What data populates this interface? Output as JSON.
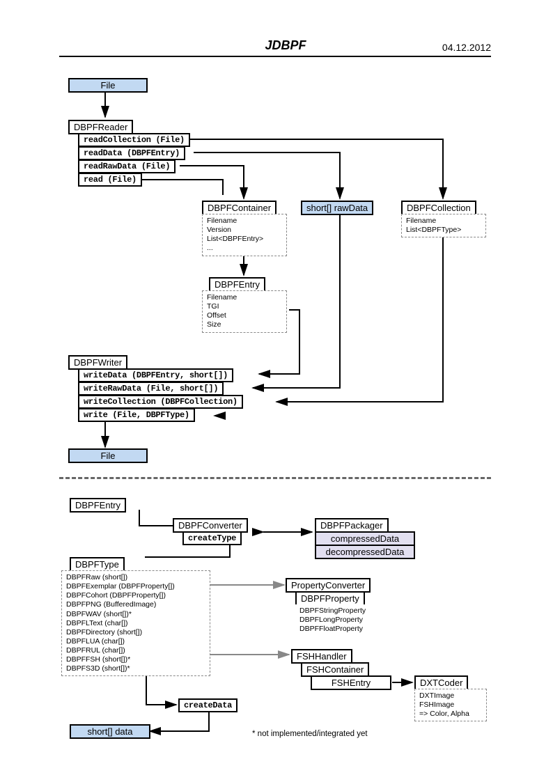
{
  "header": {
    "title": "JDBPF",
    "date": "04.12.2012"
  },
  "file_top": "File",
  "reader": {
    "name": "DBPFReader",
    "m1": "readCollection (File)",
    "m2": "readData (DBPFEntry)",
    "m3": "readRawData (File)",
    "m4": "read (File)"
  },
  "container": {
    "name": "DBPFContainer",
    "attrs": "Filename\nVersion\nList<DBPFEntry>\n..."
  },
  "rawdata": "short[] rawData",
  "collection": {
    "name": "DBPFCollection",
    "attrs": "Filename\nList<DBPFType>"
  },
  "entry": {
    "name": "DBPFEntry",
    "attrs": "Filename\nTGI\nOffset\nSize"
  },
  "writer": {
    "name": "DBPFWriter",
    "m1": "writeData (DBPFEntry, short[])",
    "m2": "writeRawData (File, short[])",
    "m3": "writeCollection (DBPFCollection)",
    "m4": "write (File, DBPFType)"
  },
  "file_bot": "File",
  "entry2": "DBPFEntry",
  "converter": {
    "name": "DBPFConverter",
    "m": "createType"
  },
  "packager": {
    "name": "DBPFPackager",
    "m1": "compressedData",
    "m2": "decompressedData"
  },
  "type": {
    "name": "DBPFType",
    "attrs": "DBPFRaw (short[])\nDBPFExemplar (DBPFProperty[])\nDBPFCohort (DBPFProperty[])\nDBPFPNG (BufferedImage)\nDBPFWAV (short[])*\nDBPFLText (char[])\nDBPFDirectory (short[])\nDBPFLUA (char[])\nDBPFRUL (char[])\nDBPFFSH (short[])*\nDBPFS3D (short[])*"
  },
  "propconv": {
    "name": "PropertyConverter",
    "sub": "DBPFProperty",
    "attrs": "DBPFStringProperty\nDBPFLongProperty\nDBPFFloatProperty"
  },
  "fsh": {
    "name": "FSHHandler",
    "sub1": "FSHContainer",
    "sub2": "FSHEntry"
  },
  "dxt": {
    "name": "DXTCoder",
    "attrs": "DXTImage\nFSHImage\n=> Color, Alpha"
  },
  "createData": "createData",
  "data": "short[] data",
  "footnote": "* not implemented/integrated yet"
}
